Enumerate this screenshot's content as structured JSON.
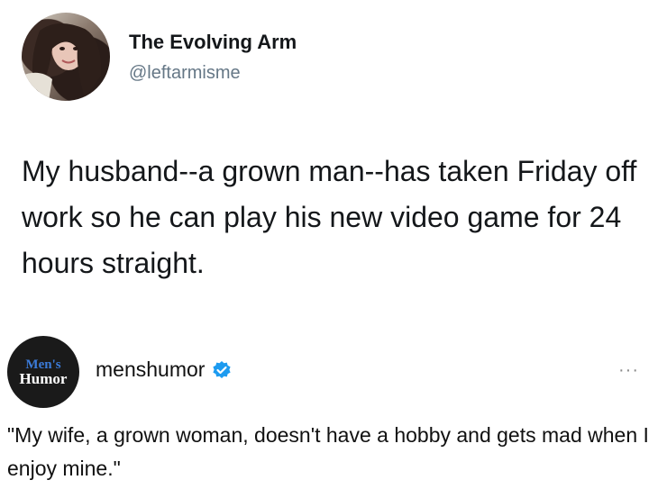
{
  "tweet": {
    "author_name": "The Evolving Arm",
    "author_handle": "@leftarmisme",
    "text": "My husband--a grown man--has taken Friday off work so he can play his new video game for 24 hours straight."
  },
  "reply": {
    "avatar_logo_top": "Men's",
    "avatar_logo_bottom": "Humor",
    "username": "menshumor",
    "verified_icon": "verified-badge-icon",
    "more_icon": "more-options-icon",
    "more_glyph": "···",
    "text": "\"My wife, a grown woman, doesn't have a hobby and gets mad when I enjoy mine.\""
  },
  "colors": {
    "handle": "#657786",
    "verified": "#1d9bf0",
    "avatar_bg": "#1a1a1a"
  }
}
